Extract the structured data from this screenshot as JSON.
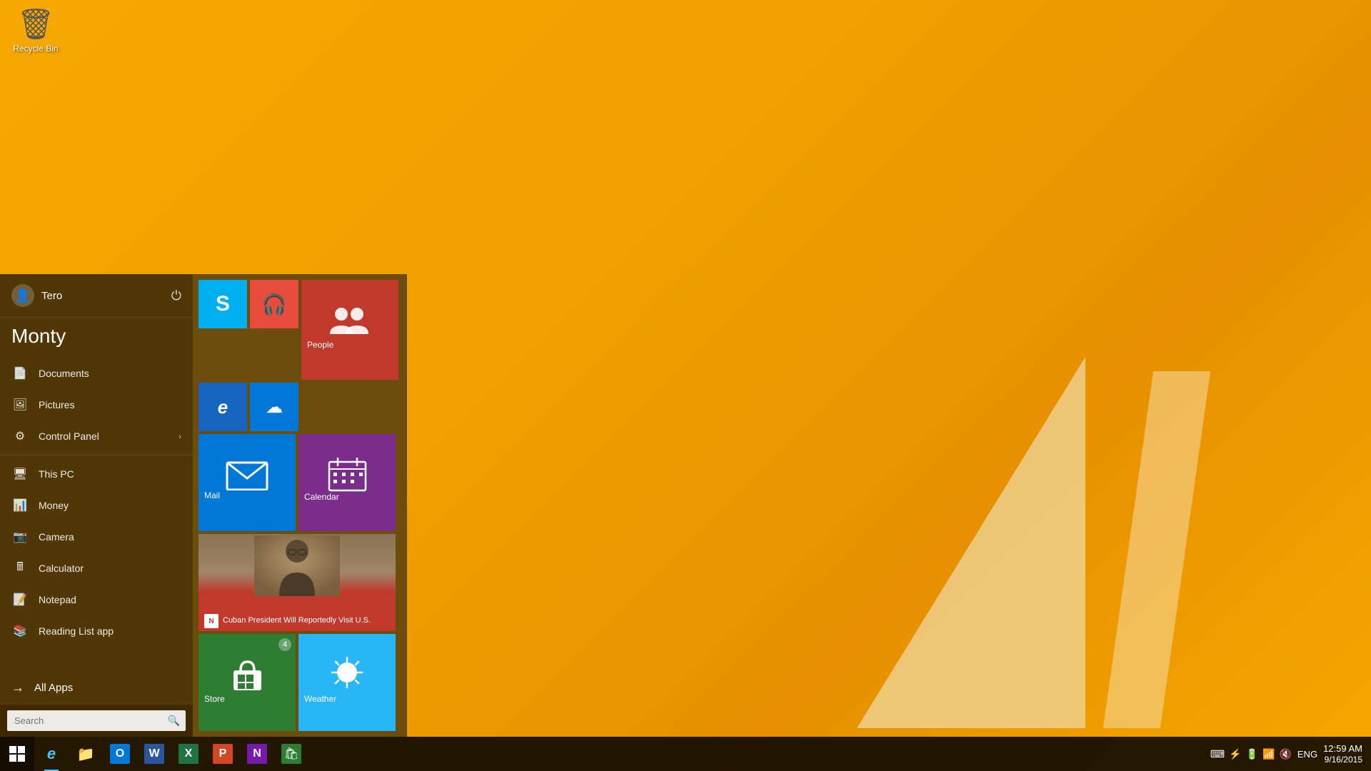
{
  "desktop": {
    "background_color": "#F5A800"
  },
  "recycle_bin": {
    "label": "Recycle Bin"
  },
  "start_menu": {
    "user": {
      "name": "Tero",
      "monty_label": "Monty"
    },
    "nav_items": [
      {
        "id": "documents",
        "label": "Documents",
        "icon": "📄"
      },
      {
        "id": "pictures",
        "label": "Pictures",
        "icon": "🖼"
      },
      {
        "id": "control-panel",
        "label": "Control Panel",
        "icon": "⚙",
        "has_arrow": true
      },
      {
        "id": "this-pc",
        "label": "This PC",
        "icon": "🖥"
      },
      {
        "id": "money",
        "label": "Money",
        "icon": "📊"
      },
      {
        "id": "camera",
        "label": "Camera",
        "icon": "📷"
      },
      {
        "id": "calculator",
        "label": "Calculator",
        "icon": "🖩"
      },
      {
        "id": "notepad",
        "label": "Notepad",
        "icon": "📝"
      },
      {
        "id": "reading-list",
        "label": "Reading List app",
        "icon": "📚"
      }
    ],
    "all_apps_label": "All Apps",
    "search_placeholder": "Search",
    "tiles": {
      "row1": [
        {
          "id": "skype",
          "label": "Skype",
          "color": "#00AFF0",
          "size": "sm",
          "icon": "S"
        },
        {
          "id": "music",
          "label": "",
          "color": "#E74C3C",
          "size": "sm",
          "icon": "🎧"
        },
        {
          "id": "people",
          "label": "People",
          "color": "#C0392B",
          "size": "md"
        }
      ],
      "row2": [
        {
          "id": "ie",
          "label": "",
          "color": "#1565C0",
          "size": "sm",
          "icon": "e"
        },
        {
          "id": "onedrive",
          "label": "",
          "color": "#0078D7",
          "size": "sm",
          "icon": "☁"
        }
      ],
      "row3": [
        {
          "id": "mail",
          "label": "Mail",
          "color": "#0078D7",
          "size": "md"
        },
        {
          "id": "calendar",
          "label": "Calendar",
          "color": "#7B2D8B",
          "size": "md"
        }
      ],
      "row4": [
        {
          "id": "news",
          "label": "Cuban President Will Reportedly Visit U.S.",
          "color": "#C0392B",
          "size": "wide"
        }
      ],
      "row5": [
        {
          "id": "store",
          "label": "Store",
          "color": "#2E7D32",
          "size": "md",
          "badge": "4"
        },
        {
          "id": "weather",
          "label": "Weather",
          "color": "#29B6F6",
          "size": "md"
        }
      ]
    }
  },
  "taskbar": {
    "apps": [
      {
        "id": "ie",
        "label": "Internet Explorer",
        "icon": "e",
        "color": "#1E90FF"
      },
      {
        "id": "explorer",
        "label": "File Explorer",
        "icon": "📁",
        "color": "#FFD700"
      },
      {
        "id": "outlook",
        "label": "Outlook",
        "icon": "O",
        "color": "#0078D7"
      },
      {
        "id": "word",
        "label": "Word",
        "icon": "W",
        "color": "#2B579A"
      },
      {
        "id": "excel",
        "label": "Excel",
        "icon": "X",
        "color": "#217346"
      },
      {
        "id": "powerpoint",
        "label": "PowerPoint",
        "icon": "P",
        "color": "#D24726"
      },
      {
        "id": "onenote",
        "label": "OneNote",
        "icon": "N",
        "color": "#7719AA"
      },
      {
        "id": "store",
        "label": "Store",
        "icon": "🛍",
        "color": "#2E7D32"
      }
    ],
    "system": {
      "language": "ENG",
      "time": "12:59 AM",
      "date": "9/16/2015"
    }
  }
}
